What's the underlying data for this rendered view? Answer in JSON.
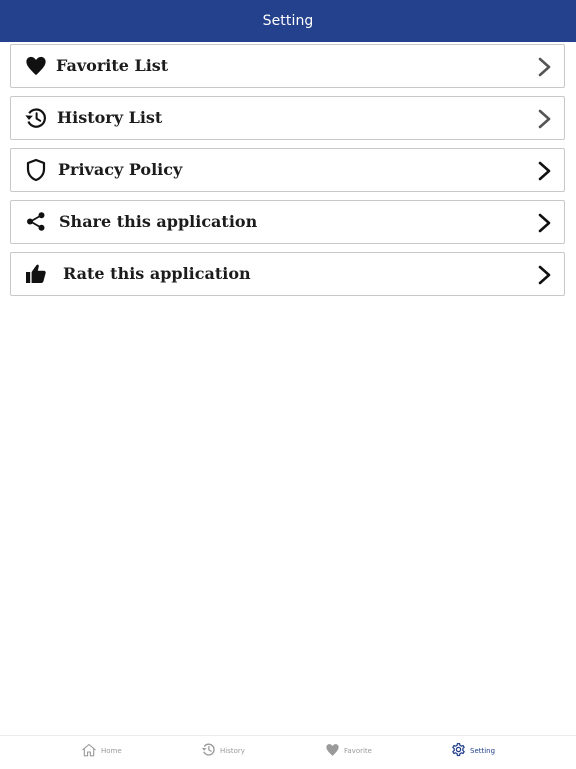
{
  "header": {
    "title": "Setting"
  },
  "settings": {
    "items": [
      {
        "label": "Favorite List",
        "icon": "heart-icon"
      },
      {
        "label": "History List",
        "icon": "history-icon"
      },
      {
        "label": "Privacy Policy",
        "icon": "shield-icon"
      },
      {
        "label": "Share this application",
        "icon": "share-icon"
      },
      {
        "label": "Rate this application",
        "icon": "thumbs-up-icon"
      }
    ]
  },
  "tabbar": {
    "tabs": [
      {
        "label": "Home",
        "icon": "home-icon",
        "active": false
      },
      {
        "label": "History",
        "icon": "history-icon",
        "active": false
      },
      {
        "label": "Favorite",
        "icon": "heart-icon",
        "active": false
      },
      {
        "label": "Setting",
        "icon": "gear-icon",
        "active": true
      }
    ]
  },
  "colors": {
    "header_bg": "#23418c",
    "active_tab": "#23418c",
    "inactive_tab": "#9a9a9a",
    "row_border": "#c9c9c9"
  }
}
